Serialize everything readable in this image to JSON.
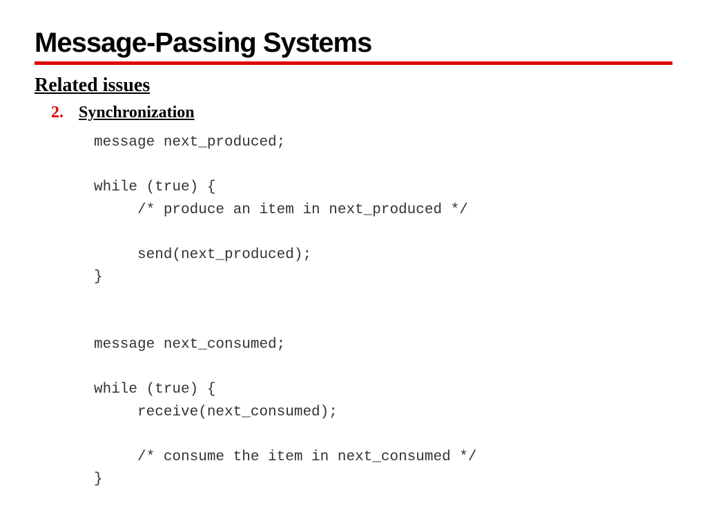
{
  "slide": {
    "title": "Message-Passing Systems",
    "subheading": "Related issues",
    "list": {
      "number": "2.",
      "text": "Synchronization"
    },
    "code": "message next_produced;\n\nwhile (true) {\n     /* produce an item in next_produced */\n\n     send(next_produced);\n}\n\n\nmessage next_consumed;\n\nwhile (true) {\n     receive(next_consumed);\n\n     /* consume the item in next_consumed */\n}"
  }
}
